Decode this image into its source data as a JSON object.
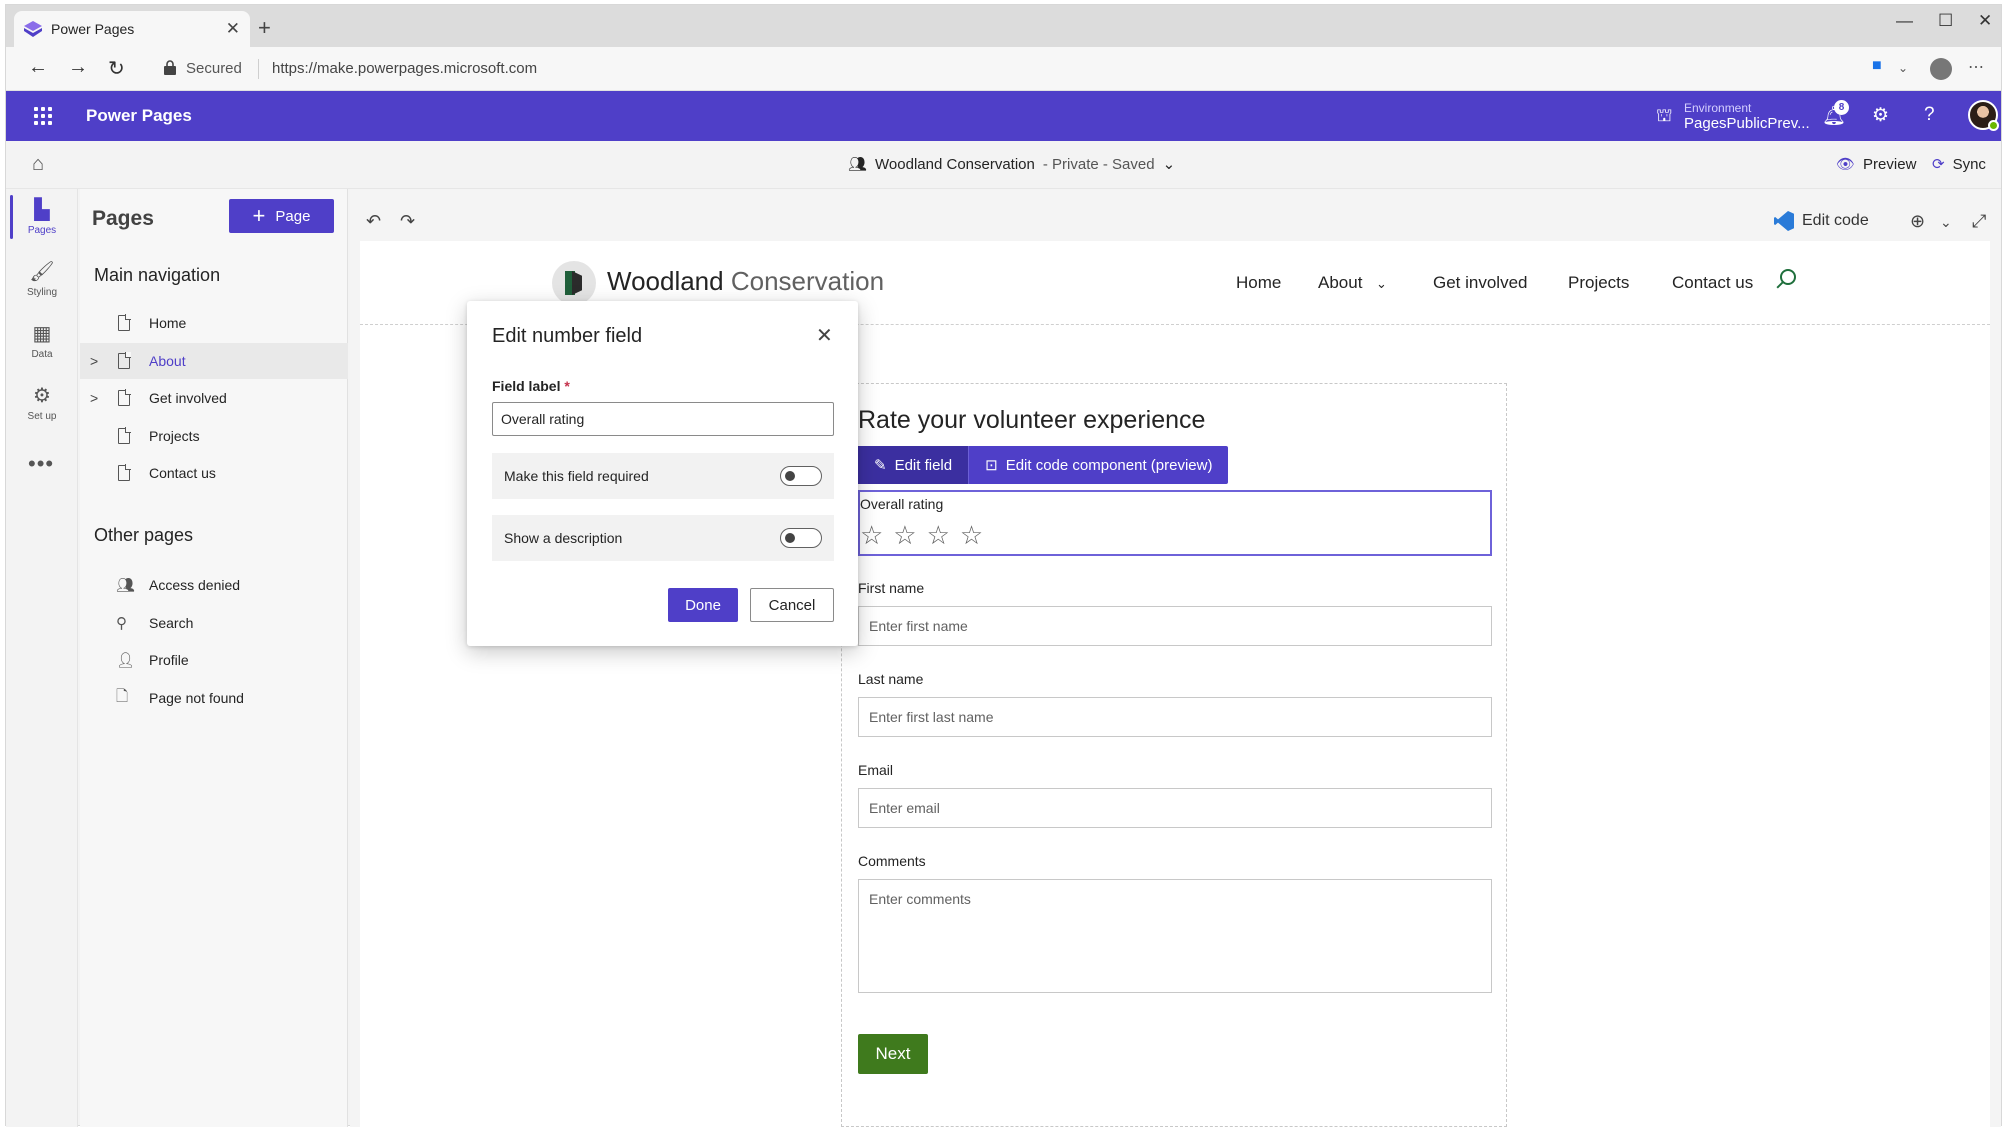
{
  "browser": {
    "tab_title": "Power Pages",
    "address_status": "Secured",
    "url": "https://make.powerpages.microsoft.com"
  },
  "app": {
    "title": "Power Pages",
    "environment_label": "Environment",
    "environment_value": "PagesPublicPrev...",
    "notification_count": "8",
    "brand_color": "#4f3fc8"
  },
  "cmdbar": {
    "site_name": "Woodland Conservation",
    "site_status": "- Private - Saved",
    "preview_label": "Preview",
    "sync_label": "Sync"
  },
  "rail": {
    "items": [
      {
        "label": "Pages",
        "icon": "page-icon"
      },
      {
        "label": "Styling",
        "icon": "paintbrush-icon"
      },
      {
        "label": "Data",
        "icon": "table-icon"
      },
      {
        "label": "Set up",
        "icon": "setup-icon"
      }
    ]
  },
  "pages_panel": {
    "title": "Pages",
    "add_button": "Page",
    "main_nav_title": "Main navigation",
    "main_nav": [
      {
        "label": "Home"
      },
      {
        "label": "About"
      },
      {
        "label": "Get involved"
      },
      {
        "label": "Projects"
      },
      {
        "label": "Contact us"
      }
    ],
    "other_title": "Other pages",
    "other_pages": [
      {
        "label": "Access denied",
        "icon": "people-lock-icon"
      },
      {
        "label": "Search",
        "icon": "search-icon"
      },
      {
        "label": "Profile",
        "icon": "person-icon"
      },
      {
        "label": "Page not found",
        "icon": "broken-page-icon"
      }
    ]
  },
  "canvas": {
    "edit_code_label": "Edit code"
  },
  "site": {
    "brand_main": "Woodland",
    "brand_light": "Conservation",
    "nav": [
      "Home",
      "About",
      "Get involved",
      "Projects",
      "Contact us"
    ],
    "form_title": "Rate your volunteer experience",
    "toolbar": {
      "edit_field": "Edit field",
      "edit_code_component": "Edit code component (preview)"
    },
    "rating_label": "Overall rating",
    "stars": "☆☆☆☆",
    "fields": [
      {
        "label": "First name",
        "placeholder": "Enter first name"
      },
      {
        "label": "Last name",
        "placeholder": "Enter first last name"
      },
      {
        "label": "Email",
        "placeholder": "Enter email"
      },
      {
        "label": "Comments",
        "placeholder": "Enter comments"
      }
    ],
    "next_button": "Next",
    "button_color": "#3f7a1d"
  },
  "dialog": {
    "title": "Edit number field",
    "field_label": "Field label",
    "required_marker": "*",
    "field_value": "Overall rating",
    "toggle_required": "Make this field required",
    "toggle_description": "Show a description",
    "done": "Done",
    "cancel": "Cancel"
  }
}
